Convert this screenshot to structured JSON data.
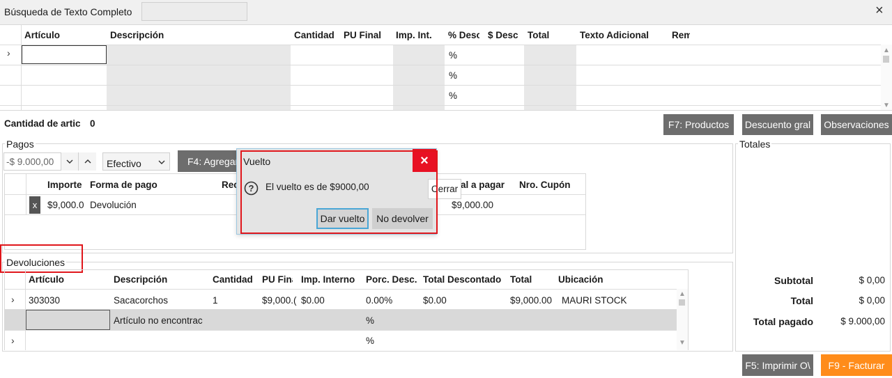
{
  "header": {
    "search_label": "Búsqueda de Texto Completo",
    "search_value": "",
    "close_glyph": "×"
  },
  "items_table": {
    "columns": [
      "Artículo",
      "Descripción",
      "Cantidad",
      "PU Final",
      "Imp. Int.",
      "% Desc",
      "$ Desc",
      "Total",
      "Texto Adicional",
      "Rem"
    ],
    "row_marker": "›",
    "percent": "%"
  },
  "summary": {
    "count_label": "Cantidad de artic",
    "count_value": "0",
    "f7_label": "F7: Productos",
    "descuento_label": "Descuento gral",
    "observaciones_label": "Observaciones"
  },
  "pagos": {
    "group_label": "Pagos",
    "amount_value": "-$ 9.000,00",
    "method_value": "Efectivo",
    "f4_label": "F4: Agregar",
    "columns": [
      "Importe",
      "Forma de pago",
      "Rec",
      "Total a pagar",
      "Nro. Cupón"
    ],
    "row": {
      "delete": "x",
      "importe": "$9,000.0",
      "forma": "Devolución",
      "total": "$9,000.00"
    }
  },
  "dialog": {
    "title": "Vuelto",
    "close_glyph": "×",
    "message": "El vuelto es de $9000,00",
    "cerrar_label": "Cerrar",
    "dar_vuelto_label": "Dar vuelto",
    "no_devolver_label": "No devolver"
  },
  "totales": {
    "group_label": "Totales",
    "subtotal_label": "Subtotal",
    "subtotal_value": "$ 0,00",
    "total_label": "Total",
    "total_value": "$ 0,00",
    "total_pagado_label": "Total pagado",
    "total_pagado_value": "$ 9.000,00"
  },
  "devoluciones": {
    "group_label": "Devoluciones",
    "columns": [
      "Artículo",
      "Descripción",
      "Cantidad",
      "PU Fina",
      "Imp. Interno",
      "Porc. Desc.",
      "Total Descontado",
      "Total",
      "Ubicación"
    ],
    "row1": {
      "articulo": "303030",
      "descripcion": "Sacacorchos",
      "cantidad": "1",
      "pu": "$9,000.(",
      "imp": "$0.00",
      "porc": "0.00%",
      "total_desc": "$0.00",
      "total": "$9,000.00",
      "ubicacion": "MAURI STOCK"
    },
    "row2": {
      "descripcion": "Artículo no encontrac",
      "porc": "%"
    },
    "row3": {
      "porc": "%"
    }
  },
  "footer": {
    "f5_label": "F5: Imprimir O\\",
    "f9_label": "F9 - Facturar"
  },
  "colors": {
    "button_gray": "#6d6d6d",
    "facturar_orange": "#ff8c1a",
    "dialog_red": "#e81123",
    "highlight_red": "#e0161b",
    "primary_border": "#49a6d6"
  }
}
